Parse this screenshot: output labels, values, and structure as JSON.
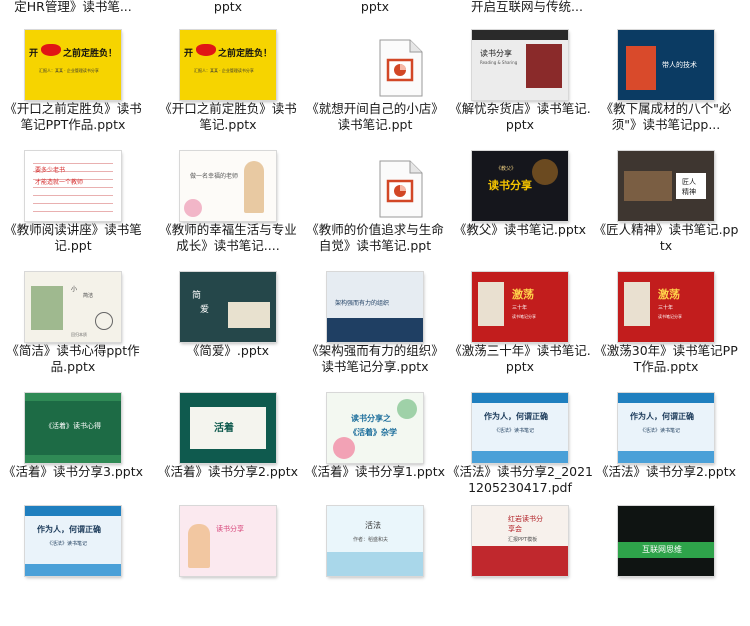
{
  "top_row": [
    {
      "name": "top-file-1",
      "label": "定HR管理》读书笔..."
    },
    {
      "name": "top-file-2",
      "label": "pptx"
    },
    {
      "name": "top-file-3",
      "label": "pptx"
    },
    {
      "name": "top-file-4",
      "label": "开启互联网与传统..."
    }
  ],
  "files": [
    {
      "label": "《开口之前定胜负》读书笔记PPT作品.pptx",
      "thumb": {
        "kind": "kaikou",
        "words": [
          "开",
          "之前定胜负！",
          "汇报人：某某 · 企业管理读书分享"
        ]
      }
    },
    {
      "label": "《开口之前定胜负》读书笔记.pptx",
      "thumb": {
        "kind": "kaikou",
        "words": [
          "开",
          "之前定胜负！",
          "汇报人：某某 · 企业管理读书分享"
        ]
      }
    },
    {
      "label": "《就想开间自己的小店》读书笔记.ppt",
      "thumb": {
        "kind": "icon"
      }
    },
    {
      "label": "《解忧杂货店》读书笔记.pptx",
      "thumb": {
        "kind": "jieyou",
        "words": [
          "读书分享",
          "Reading & Sharing"
        ]
      }
    },
    {
      "label": "《教下属成材的八个\"必须\"》读书笔记pp...",
      "thumb": {
        "kind": "jiaoxia",
        "words": [
          "带人的技术"
        ]
      }
    },
    {
      "label": "《教师阅读讲座》读书笔记.ppt",
      "thumb": {
        "kind": "redlines",
        "words": [
          "要多少老书",
          "才能造就一个教师"
        ]
      }
    },
    {
      "label": "《教师的幸福生活与专业成长》读书笔记....",
      "thumb": {
        "kind": "floral",
        "words": [
          "做一名幸福的老师"
        ]
      }
    },
    {
      "label": "《教师的价值追求与生命自觉》读书笔记.ppt",
      "thumb": {
        "kind": "icon"
      }
    },
    {
      "label": "《教父》读书笔记.pptx",
      "thumb": {
        "kind": "jiaofu",
        "words": [
          "《教父》",
          "读书分享"
        ]
      }
    },
    {
      "label": "《匠人精神》读书笔记.pptx",
      "thumb": {
        "kind": "jiangren",
        "words": [
          "匠人",
          "精神"
        ]
      }
    },
    {
      "label": "《简洁》读书心得ppt作品.pptx",
      "thumb": {
        "kind": "jianjie",
        "words": [
          "小",
          "简洁",
          "回归本质"
        ]
      }
    },
    {
      "label": "《简爱》.pptx",
      "thumb": {
        "kind": "jianai",
        "words": [
          "简",
          "爱"
        ]
      }
    },
    {
      "label": "《架构强而有力的组织》读书笔记分享.pptx",
      "thumb": {
        "kind": "jiagou",
        "words": [
          "架构强而有力的组织"
        ]
      }
    },
    {
      "label": "《激荡三十年》读书笔记.pptx",
      "thumb": {
        "kind": "jidang",
        "words": [
          "激荡",
          "三十年",
          "读书笔记分享"
        ]
      }
    },
    {
      "label": "《激荡30年》读书笔记PPT作品.pptx",
      "thumb": {
        "kind": "jidang",
        "words": [
          "激荡",
          "三十年",
          "读书笔记分享"
        ]
      }
    },
    {
      "label": "《活着》读书分享3.pptx",
      "thumb": {
        "kind": "huozhe3",
        "words": [
          "《活着》读书心得"
        ]
      }
    },
    {
      "label": "《活着》读书分享2.pptx",
      "thumb": {
        "kind": "huozhe2",
        "words": [
          "活着"
        ]
      }
    },
    {
      "label": "《活着》读书分享1.pptx",
      "thumb": {
        "kind": "huozhe1",
        "words": [
          "读书分享之",
          "《活着》杂学"
        ]
      }
    },
    {
      "label": "《活法》读书分享2_20211205230417.pdf",
      "thumb": {
        "kind": "huofa",
        "words": [
          "作为人，何谓正确",
          "《活法》读书笔记"
        ]
      }
    },
    {
      "label": "《活法》读书分享2.pptx",
      "thumb": {
        "kind": "huofa",
        "words": [
          "作为人，何谓正确",
          "《活法》读书笔记"
        ]
      }
    },
    {
      "label": "",
      "thumb": {
        "kind": "huofa",
        "words": [
          "作为人，何谓正确",
          "《活法》读书笔记"
        ]
      }
    },
    {
      "label": "",
      "thumb": {
        "kind": "cartoon",
        "words": [
          "读书分享"
        ]
      }
    },
    {
      "label": "",
      "thumb": {
        "kind": "watercolor",
        "words": [
          "活法",
          "作者：稻盛和夫"
        ]
      }
    },
    {
      "label": "",
      "thumb": {
        "kind": "hongyan",
        "words": [
          "红岩读书分",
          "享会",
          "汇报PPT模板"
        ]
      }
    },
    {
      "label": "",
      "thumb": {
        "kind": "hulian",
        "words": [
          "互联网思维"
        ]
      }
    }
  ]
}
